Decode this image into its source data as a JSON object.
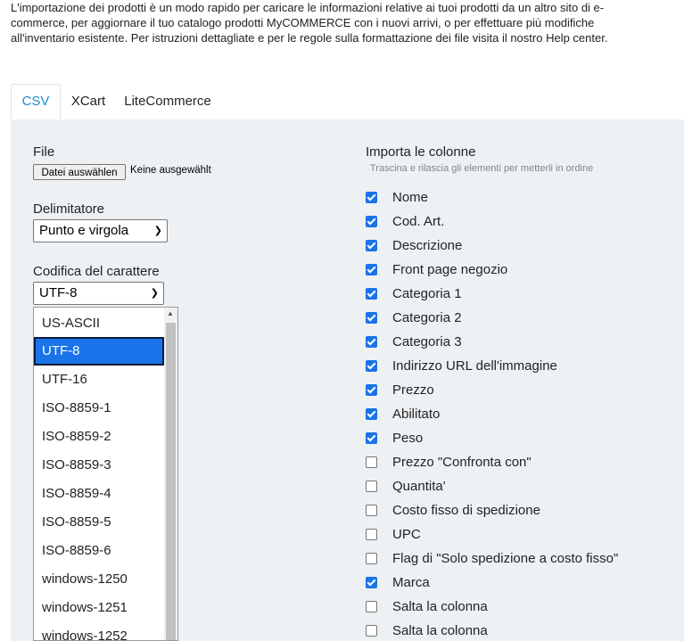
{
  "intro_lines": [
    "L'importazione dei prodotti è un modo rapido per caricare le informazioni relative ai tuoi prodotti da un altro sito di e-",
    "commerce, per aggiornare il tuo catalogo prodotti MyCOMMERCE con i nuovi arrivi, o per effettuare più modifiche",
    "all'inventario esistente. Per istruzioni dettagliate e per le regole sulla formattazione dei file visita il nostro Help center."
  ],
  "tabs": [
    {
      "label": "CSV",
      "active": true
    },
    {
      "label": "XCart",
      "active": false
    },
    {
      "label": "LiteCommerce",
      "active": false
    }
  ],
  "file": {
    "label": "File",
    "button": "Datei auswählen",
    "status": "Keine ausgewählt"
  },
  "delimiter": {
    "label": "Delimitatore",
    "value": "Punto e virgola"
  },
  "encoding": {
    "label": "Codifica del carattere",
    "value": "UTF-8",
    "options": [
      "US-ASCII",
      "UTF-8",
      "UTF-16",
      "ISO-8859-1",
      "ISO-8859-2",
      "ISO-8859-3",
      "ISO-8859-4",
      "ISO-8859-5",
      "ISO-8859-6",
      "windows-1250",
      "windows-1251",
      "windows-1252"
    ],
    "selected_index": 1
  },
  "columns": {
    "title": "Importa le colonne",
    "hint": "Trascina e rilascia gli elementi per metterli in ordine",
    "items": [
      {
        "label": "Nome",
        "checked": true
      },
      {
        "label": "Cod. Art.",
        "checked": true
      },
      {
        "label": "Descrizione",
        "checked": true
      },
      {
        "label": "Front page negozio",
        "checked": true
      },
      {
        "label": "Categoria 1",
        "checked": true
      },
      {
        "label": "Categoria 2",
        "checked": true
      },
      {
        "label": "Categoria 3",
        "checked": true
      },
      {
        "label": "Indirizzo URL dell'immagine",
        "checked": true
      },
      {
        "label": "Prezzo",
        "checked": true
      },
      {
        "label": "Abilitato",
        "checked": true
      },
      {
        "label": "Peso",
        "checked": true
      },
      {
        "label": "Prezzo \"Confronta con\"",
        "checked": false
      },
      {
        "label": "Quantita'",
        "checked": false
      },
      {
        "label": "Costo fisso di spedizione",
        "checked": false
      },
      {
        "label": "UPC",
        "checked": false
      },
      {
        "label": "Flag di \"Solo spedizione a costo fisso\"",
        "checked": false
      },
      {
        "label": "Marca",
        "checked": true
      },
      {
        "label": "Salta la colonna",
        "checked": false
      },
      {
        "label": "Salta la colonna",
        "checked": false
      }
    ]
  },
  "colors": {
    "accent": "#1a73e8",
    "tab_active": "#1a8ad1",
    "panel_bg": "#eef1f4"
  }
}
